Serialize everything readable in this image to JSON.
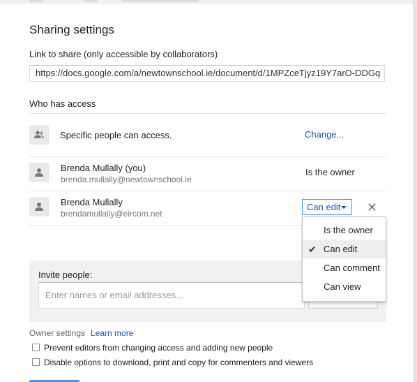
{
  "dialog": {
    "title": "Sharing settings"
  },
  "link": {
    "label": "Link to share (only accessible by collaborators)",
    "value": "https://docs.google.com/a/newtownschool.ie/document/d/1MPZceTjyz19Y7arO-DDGq"
  },
  "access": {
    "label": "Who has access",
    "general": {
      "text": "Specific people can access.",
      "change_label": "Change..."
    },
    "people": [
      {
        "name": "Brenda Mullally (you)",
        "email": "brenda.mullally@newtownschool.ie",
        "role": "Is the owner"
      },
      {
        "name": "Brenda Mullally",
        "email": "brendamullally@eircom.net",
        "role": "Can edit"
      }
    ]
  },
  "permission_menu": {
    "items": [
      "Is the owner",
      "Can edit",
      "Can comment",
      "Can view"
    ],
    "selected": "Can edit"
  },
  "invite": {
    "label": "Invite people:",
    "placeholder": "Enter names or email addresses..."
  },
  "owner_settings": {
    "label": "Owner settings",
    "learn_more": "Learn more",
    "options": [
      {
        "label": "Prevent editors from changing access and adding new people",
        "checked": false
      },
      {
        "label": "Disable options to download, print and copy for commenters and viewers",
        "checked": false
      }
    ]
  },
  "colors": {
    "link": "#1155cc",
    "focus_border": "#4d90fe",
    "panel_bg": "#f1f1f1"
  },
  "icons": {
    "general_access": "people-icon",
    "person": "person-icon",
    "check": "checkmark-icon",
    "remove": "close-icon",
    "dropdown": "caret-down-icon"
  }
}
